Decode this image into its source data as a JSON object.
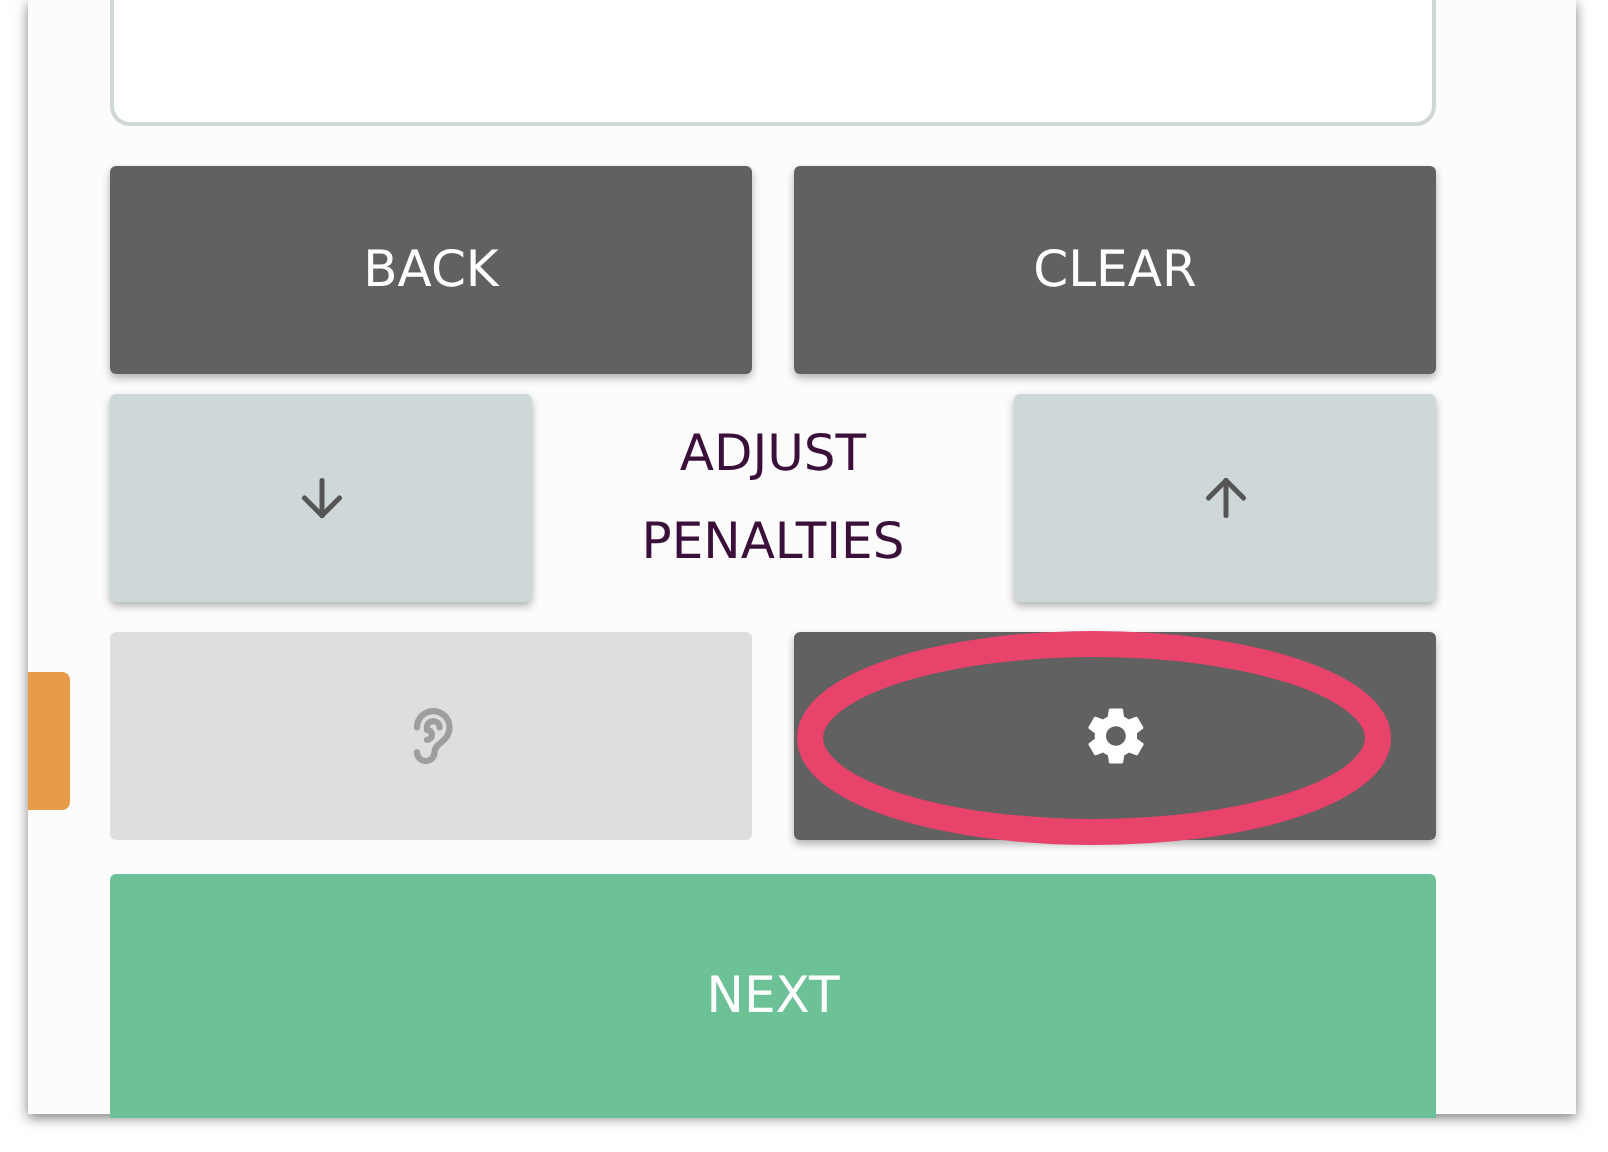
{
  "action_row": [
    {
      "label": "BACK"
    },
    {
      "label": "CLEAR"
    }
  ],
  "adjust": {
    "label": "ADJUST PENALTIES"
  },
  "tool_row": [
    {
      "kind": "hearing",
      "disabled": true
    },
    {
      "kind": "settings",
      "disabled": false,
      "highlighted": true
    }
  ],
  "next_button": {
    "label": "NEXT"
  }
}
